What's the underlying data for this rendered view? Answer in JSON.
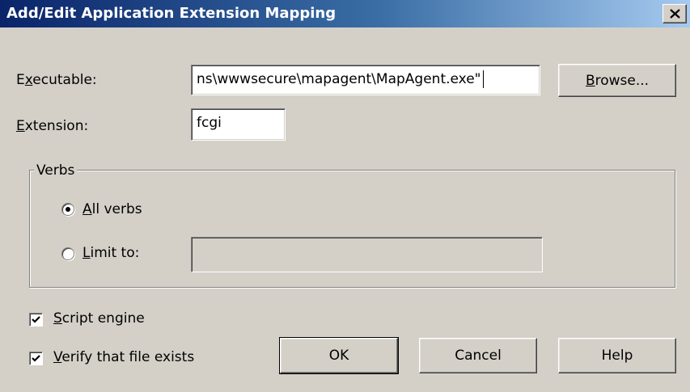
{
  "window": {
    "title": "Add/Edit Application Extension Mapping",
    "close_glyph": "×"
  },
  "executable": {
    "label_mnemonic": "x",
    "label_pre": "E",
    "label_post": "ecutable:",
    "value": "ns\\wwwsecure\\mapagent\\MapAgent.exe\""
  },
  "browse_button": {
    "label_mnemonic": "B",
    "label_rest": "rowse..."
  },
  "extension": {
    "label_mnemonic": "E",
    "label_rest": "xtension:",
    "value": "fcgi"
  },
  "verbs": {
    "group_label": "Verbs",
    "all_verbs": {
      "label_mnemonic": "A",
      "label_rest": "ll verbs",
      "selected": true
    },
    "limit_to": {
      "label_mnemonic": "L",
      "label_rest": "imit to:",
      "selected": false,
      "value": ""
    }
  },
  "script_engine": {
    "label_mnemonic": "S",
    "label_rest": "cript engine",
    "checked": true
  },
  "verify_file": {
    "label_mnemonic": "V",
    "label_rest": "erify that file exists",
    "checked": true
  },
  "buttons": {
    "ok": "OK",
    "cancel": "Cancel",
    "help": "Help"
  },
  "icons": {
    "close": "close-icon",
    "radio_selected": "radio-selected-icon",
    "check": "checkmark-icon"
  }
}
